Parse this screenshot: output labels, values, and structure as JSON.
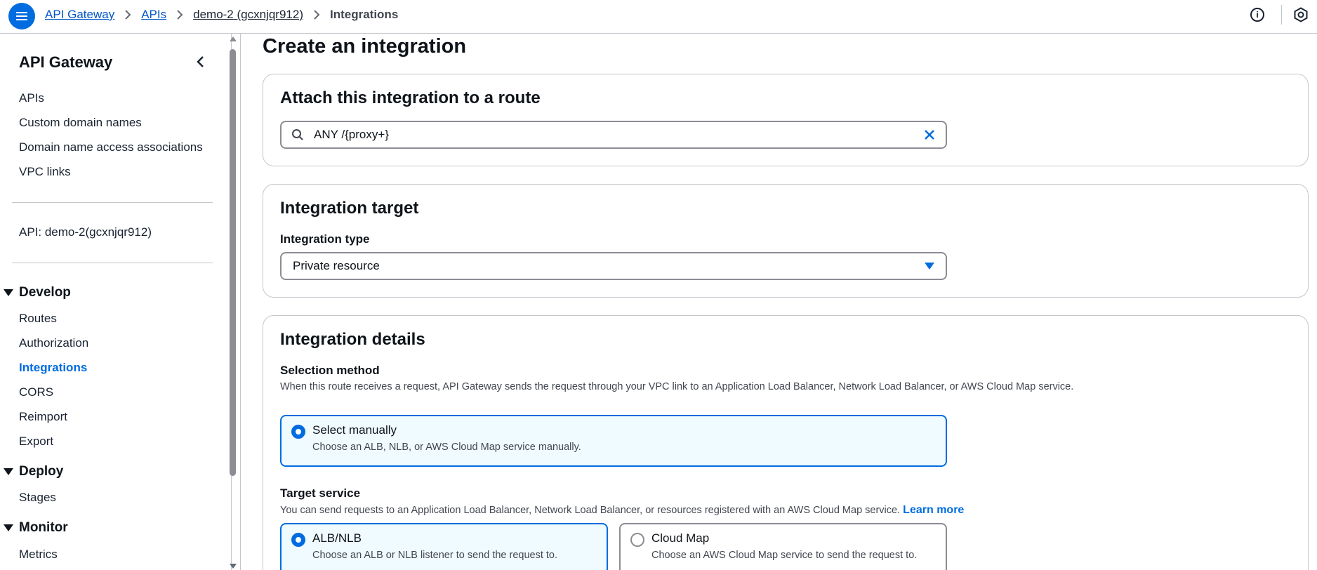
{
  "breadcrumbs": {
    "items": [
      "API Gateway",
      "APIs",
      "demo-2 (gcxnjqr912)"
    ],
    "current": "Integrations"
  },
  "topbar": {
    "info_icon_glyph": "i"
  },
  "sidebar": {
    "title": "API Gateway",
    "top_links": [
      "APIs",
      "Custom domain names",
      "Domain name access associations",
      "VPC links"
    ],
    "api_label": "API: demo-2(gcxnjqr912)",
    "sections": [
      {
        "title": "Develop",
        "items": [
          "Routes",
          "Authorization",
          "Integrations",
          "CORS",
          "Reimport",
          "Export"
        ]
      },
      {
        "title": "Deploy",
        "items": [
          "Stages"
        ]
      },
      {
        "title": "Monitor",
        "items": [
          "Metrics"
        ]
      }
    ],
    "active_item": "Integrations"
  },
  "main": {
    "page_title": "Create an integration",
    "route_panel": {
      "heading": "Attach this integration to a route",
      "search_value": "ANY /{proxy+}"
    },
    "target_panel": {
      "heading": "Integration target",
      "type_label": "Integration type",
      "type_value": "Private resource"
    },
    "details_panel": {
      "heading": "Integration details",
      "selection_label": "Selection method",
      "selection_desc": "When this route receives a request, API Gateway sends the request through your VPC link to an Application Load Balancer, Network Load Balancer, or AWS Cloud Map service.",
      "manual_option": {
        "label": "Select manually",
        "desc": "Choose an ALB, NLB, or AWS Cloud Map service manually."
      },
      "target_service_label": "Target service",
      "target_service_desc": "You can send requests to an Application Load Balancer, Network Load Balancer, or resources registered with an AWS Cloud Map service.",
      "learn_more": "Learn more",
      "alb_option": {
        "label": "ALB/NLB",
        "desc": "Choose an ALB or NLB listener to send the request to.",
        "selected": true
      },
      "cloudmap_option": {
        "label": "Cloud Map",
        "desc": "Choose an AWS Cloud Map service to send the request to.",
        "selected": false
      }
    }
  },
  "colors": {
    "accent": "#006ce0",
    "selected_bg": "#f0fbff",
    "border": "#8c8c94"
  }
}
